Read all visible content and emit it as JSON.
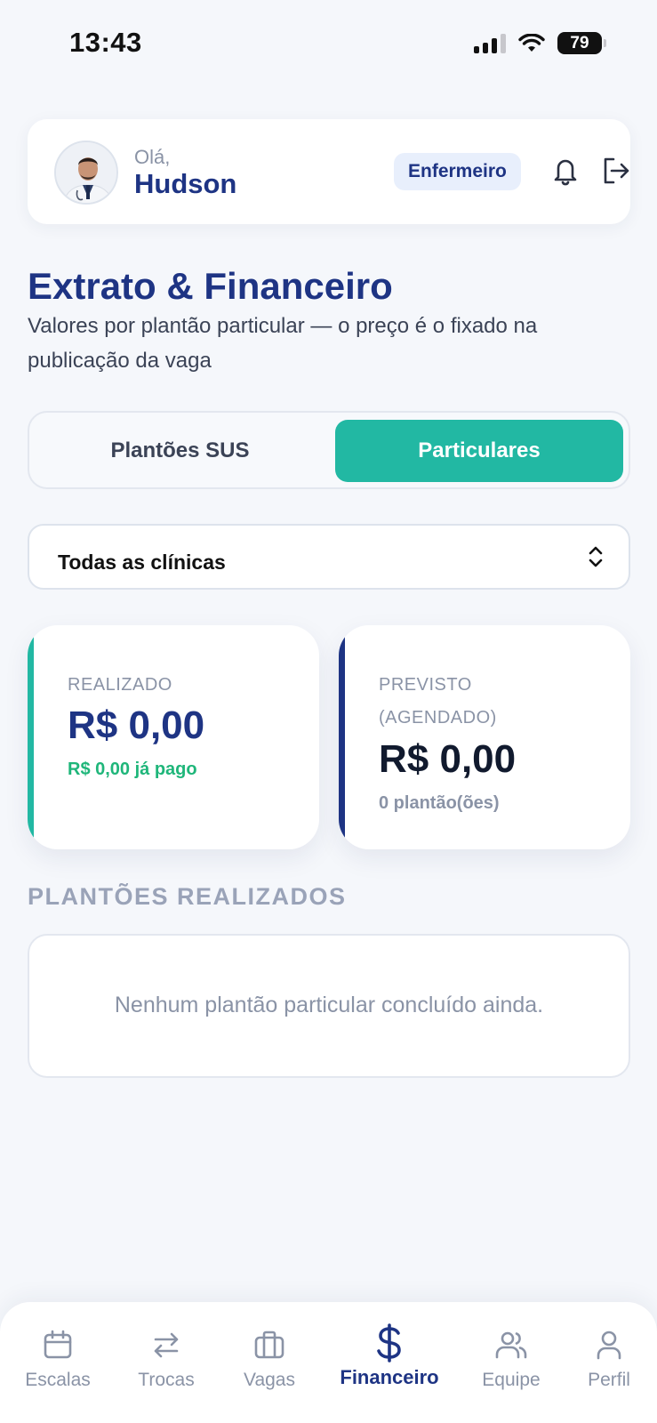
{
  "status_bar": {
    "time": "13:43",
    "battery": "79"
  },
  "header": {
    "greeting": "Olá,",
    "user_name": "Hudson",
    "role": "Enfermeiro"
  },
  "page": {
    "title": "Extrato & Financeiro",
    "subtitle": "Valores por plantão particular — o preço é o fixado na publicação da vaga"
  },
  "tabs": [
    {
      "label": "Plantões SUS",
      "active": false
    },
    {
      "label": "Particulares",
      "active": true
    }
  ],
  "clinic_select": {
    "value": "Todas as clínicas"
  },
  "cards": {
    "realizado": {
      "label": "REALIZADO",
      "value": "R$ 0,00",
      "sub": "R$ 0,00 já pago"
    },
    "previsto": {
      "label_line1": "PREVISTO",
      "label_line2": "(AGENDADO)",
      "value": "R$ 0,00",
      "sub": "0 plantão(ões)"
    }
  },
  "section": {
    "title": "PLANTÕES REALIZADOS",
    "empty_message": "Nenhum plantão particular concluído ainda."
  },
  "colors": {
    "primary": "#1e3484",
    "teal": "#22b8a3",
    "green_text": "#1fb67a",
    "muted": "#8a93a6"
  },
  "nav": [
    {
      "label": "Escalas",
      "icon": "calendar-icon"
    },
    {
      "label": "Trocas",
      "icon": "swap-arrows-icon"
    },
    {
      "label": "Vagas",
      "icon": "briefcase-icon"
    },
    {
      "label": "Financeiro",
      "icon": "dollar-icon",
      "active": true
    },
    {
      "label": "Equipe",
      "icon": "users-icon"
    },
    {
      "label": "Perfil",
      "icon": "user-icon"
    }
  ]
}
